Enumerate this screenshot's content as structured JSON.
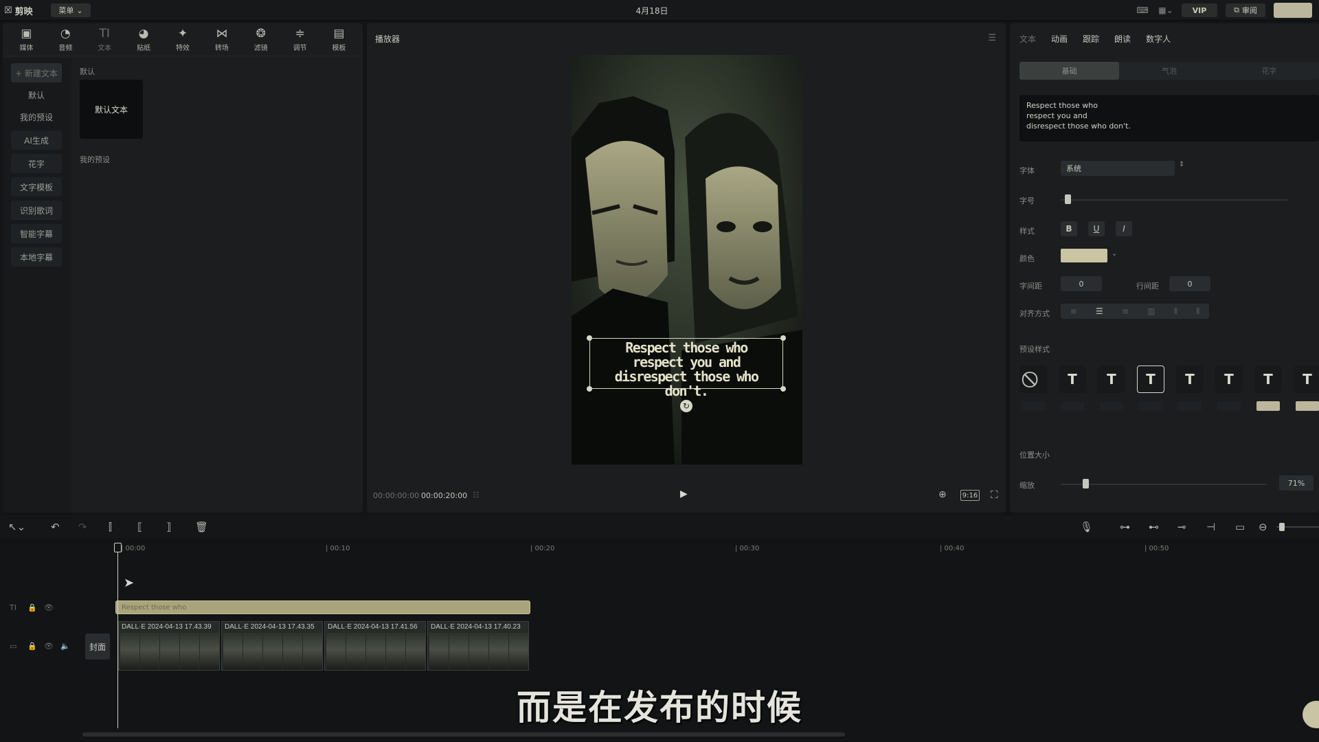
{
  "app": {
    "logo_text": "剪映",
    "menu_label": "菜单",
    "title": "4月18日"
  },
  "topbar": {
    "vip_label": "VIP",
    "share_label": "审阅"
  },
  "tools": [
    {
      "icon": "media-icon",
      "glyph": "▣",
      "label": "媒体"
    },
    {
      "icon": "audio-icon",
      "glyph": "◔",
      "label": "音频"
    },
    {
      "icon": "text-icon",
      "glyph": "TI",
      "label": "文本"
    },
    {
      "icon": "sticker-icon",
      "glyph": "◕",
      "label": "贴纸"
    },
    {
      "icon": "effects-icon",
      "glyph": "✦",
      "label": "特效"
    },
    {
      "icon": "transition-icon",
      "glyph": "⋈",
      "label": "转场"
    },
    {
      "icon": "filter-icon",
      "glyph": "❂",
      "label": "滤镜"
    },
    {
      "icon": "adjust-icon",
      "glyph": "≑",
      "label": "调节"
    },
    {
      "icon": "template-icon",
      "glyph": "▤",
      "label": "模板"
    }
  ],
  "sidebar": {
    "items": [
      "+ 新建文本",
      "默认",
      "我的预设",
      "AI生成",
      "花字",
      "文字模板",
      "识别歌词",
      "智能字幕",
      "本地字幕"
    ]
  },
  "library": {
    "default_label": "默认",
    "card_label": "默认文本",
    "my_presets_label": "我的预设"
  },
  "player": {
    "header": "播放器",
    "current_time": "00:00:00:00",
    "total_time": "00:00:20:00",
    "aspect_ratio": "9:16",
    "subtitle_lines": [
      "Respect those who",
      "respect you and",
      "disrespect those who don't."
    ]
  },
  "inspector": {
    "tabs": [
      "文本",
      "动画",
      "跟踪",
      "朗读",
      "数字人"
    ],
    "segments": [
      "基础",
      "气泡",
      "花字"
    ],
    "text_value": "Respect those who\nrespect you and\ndisrespect those who don't.",
    "font_label": "字体",
    "font_value": "系统",
    "size_label": "字号",
    "style_label": "样式",
    "bold": "B",
    "underline": "U",
    "italic": "I",
    "color_label": "颜色",
    "color_value": "#c9c4a4",
    "char_spacing_label": "字间距",
    "char_spacing_value": "0",
    "line_spacing_label": "行间距",
    "line_spacing_value": "0",
    "align_label": "对齐方式",
    "preset_label": "预设样式",
    "position_label": "位置大小",
    "scale_label": "缩放",
    "scale_value": "71%",
    "scale_fraction": 0.71
  },
  "timeline": {
    "ruler": [
      "00:00",
      "00:10",
      "00:20",
      "00:30",
      "00:40",
      "00:50"
    ],
    "text_clip_label": "Respect those who",
    "cover_label": "封面",
    "video_clips": [
      "DALL·E 2024-04-13 17.43.39",
      "DALL·E 2024-04-13 17.43.35",
      "DALL·E 2024-04-13 17.41.56",
      "DALL·E 2024-04-13 17.40.23"
    ]
  },
  "caption": "而是在发布的时候",
  "colors": {
    "accent": "#c9c4a4",
    "background": "#121416",
    "panel": "#1b1d1f"
  }
}
